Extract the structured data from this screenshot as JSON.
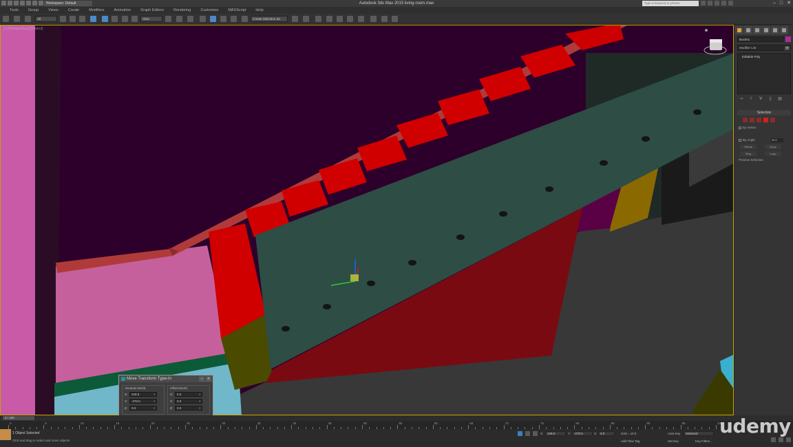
{
  "window": {
    "workspace": "Workspace: Default",
    "title": "Autodesk 3ds Max  2015    living-room.max",
    "search_placeholder": "Type a keyword or phrase",
    "controls": [
      "–",
      "□",
      "✕"
    ]
  },
  "menu": [
    "Tools",
    "Group",
    "Views",
    "Create",
    "Modifiers",
    "Animation",
    "Graph Editors",
    "Rendering",
    "Customize",
    "MAXScript",
    "Help"
  ],
  "toolbar": {
    "filter_value": "All",
    "coord_value": "View",
    "selection_set": "Create Selection Se"
  },
  "viewport": {
    "label": "[+] [Perspective] [Shaded]",
    "colors": {
      "background": "#2c002a",
      "wall_pink": "#c95aa8",
      "stair_red": "#d10000",
      "stringer": "#2b4a42",
      "rail": "#b03a3a",
      "floor": "#3a3a3a",
      "landing": "#c6609c"
    }
  },
  "command_panel": {
    "object_name": "Box001",
    "modifier_list": "Modifier List",
    "stack_item": "Editable Poly",
    "selection_header": "Selection",
    "by_vertex": "By Vertex",
    "by_angle": "By Angle",
    "angle_value": "45.0",
    "shrink": "Shrink",
    "grow": "Grow",
    "ring": "Ring",
    "loop": "Loop",
    "preview_selection": "Preview Selection"
  },
  "move_transform": {
    "title": "Move Transform Type-In",
    "absolute_label": "Absolute:World",
    "offset_label": "Offset:World",
    "absolute": {
      "x": "249.5",
      "y": "-270.5",
      "z": "0.0"
    },
    "offset": {
      "x": "0.0",
      "y": "0.0",
      "z": "0.0"
    }
  },
  "timeline": {
    "frame": "0 / 100",
    "ticks": [
      0,
      5,
      10,
      15,
      20,
      25,
      30,
      35,
      40,
      45,
      50,
      55,
      60,
      65,
      70,
      75,
      80,
      85,
      90,
      95,
      100
    ]
  },
  "status": {
    "objects_selected": "1 Object Selected",
    "prompt": "Click and drag to select and move objects",
    "x": "249.5",
    "y": "-270.5",
    "z": "0.0",
    "grid": "Grid = 10.0",
    "add_time_tag": "Add Time Tag",
    "auto_key": "Auto Key",
    "selected": "Selected",
    "set_key": "Set Key",
    "key_filters": "Key Filters..."
  },
  "watermark": "udemy"
}
